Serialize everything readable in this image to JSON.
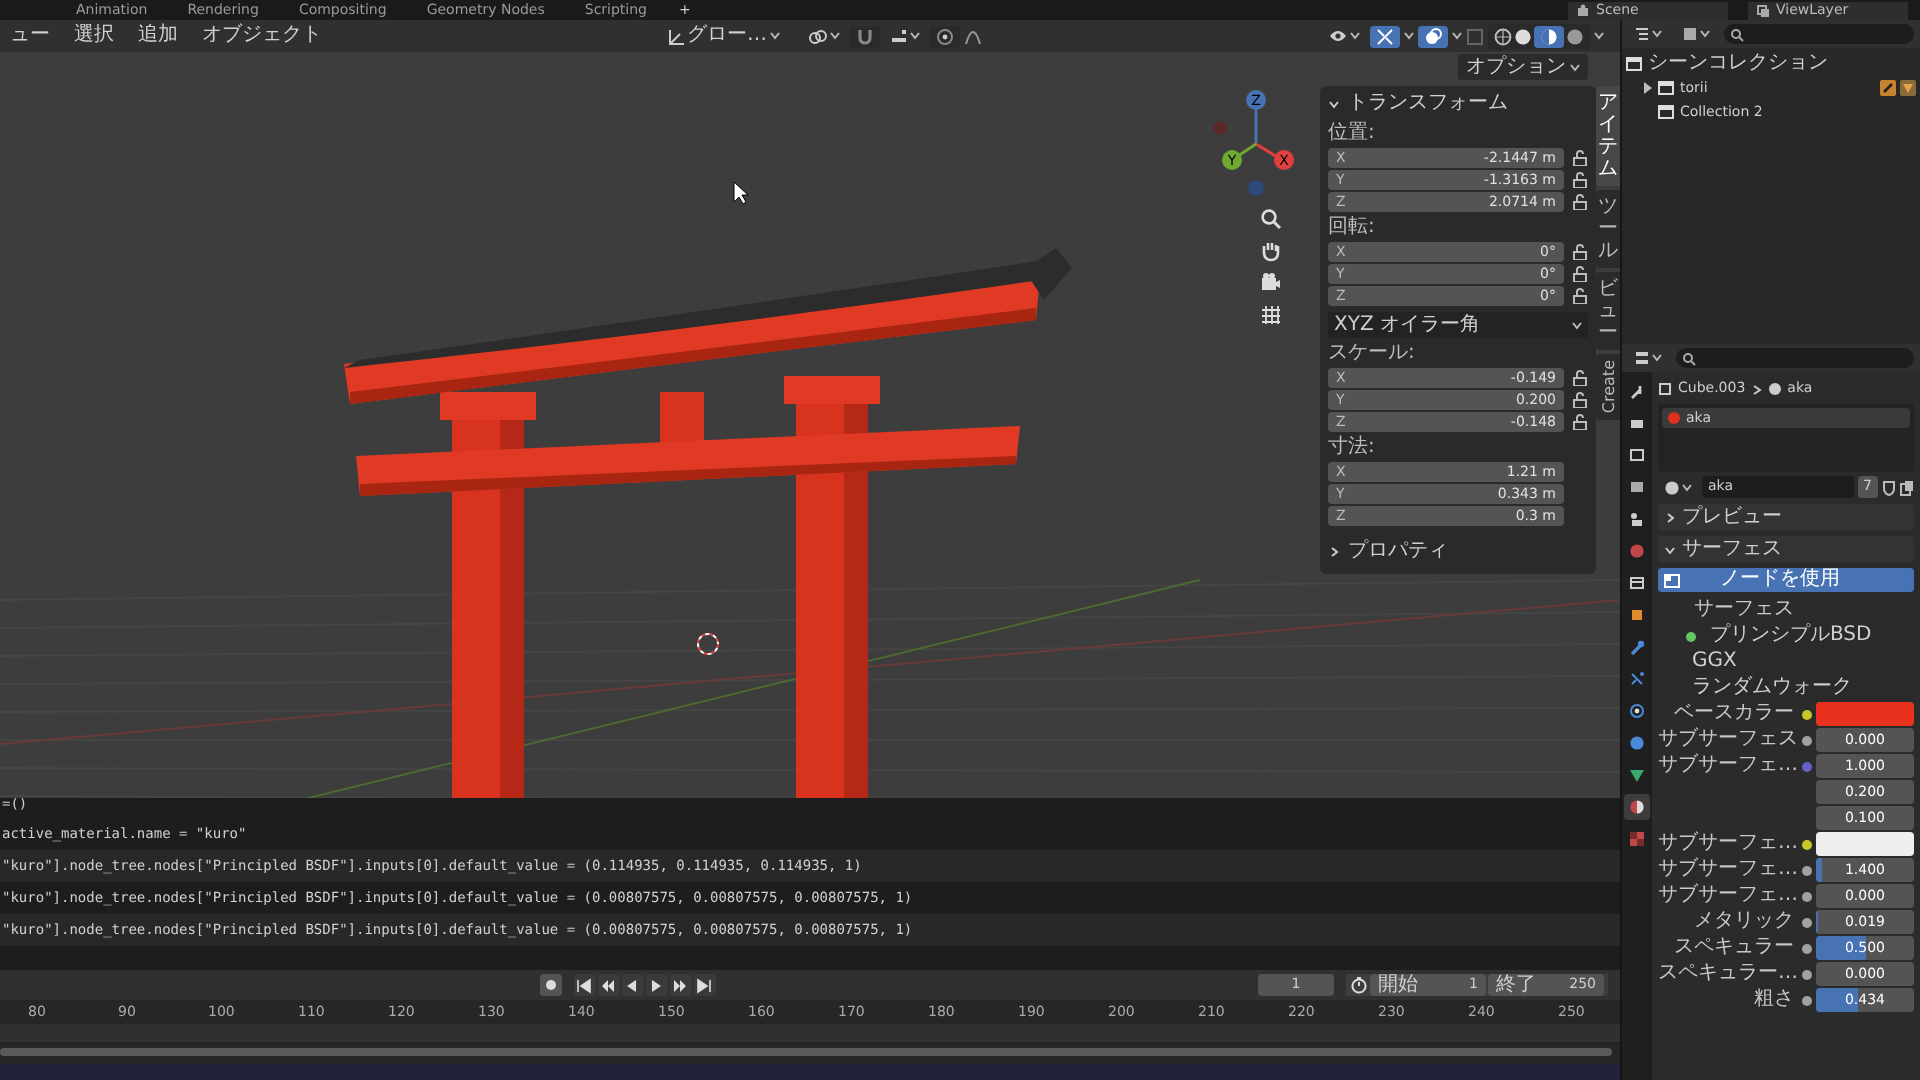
{
  "workspace_tabs": [
    {
      "label": "Animation",
      "selected": false
    },
    {
      "label": "Rendering",
      "selected": false
    },
    {
      "label": "Compositing",
      "selected": false
    },
    {
      "label": "Geometry Nodes",
      "selected": false
    },
    {
      "label": "Scripting",
      "selected": false
    }
  ],
  "add_workspace": "+",
  "scene": "Scene",
  "view_layer": "ViewLayer",
  "viewport": {
    "menus": [
      "ュー",
      "選択",
      "追加",
      "オブジェクト"
    ],
    "orientation": "グロー…",
    "options": "オプション",
    "gizmo_axes": [
      "Z",
      "Y",
      "X"
    ],
    "sidebar_tabs": [
      {
        "label": "アイテム",
        "selected": true
      },
      {
        "label": "ツール",
        "selected": false
      },
      {
        "label": "ビュー",
        "selected": false
      },
      {
        "label": "Create",
        "selected": false
      }
    ],
    "transform": {
      "title": "トランスフォーム",
      "expanded": true,
      "groups": [
        {
          "kind": "fields",
          "label": "位置:",
          "locks": true,
          "fields": [
            {
              "axis": "X",
              "value": "-2.1447 m"
            },
            {
              "axis": "Y",
              "value": "-1.3163 m"
            },
            {
              "axis": "Z",
              "value": "2.0714 m"
            }
          ]
        },
        {
          "kind": "fields",
          "label": "回転:",
          "locks": true,
          "fields": [
            {
              "axis": "X",
              "value": "0°"
            },
            {
              "axis": "Y",
              "value": "0°"
            },
            {
              "axis": "Z",
              "value": "0°"
            }
          ]
        },
        {
          "kind": "dropdown",
          "value": "XYZ オイラー角"
        },
        {
          "kind": "fields",
          "label": "スケール:",
          "locks": true,
          "fields": [
            {
              "axis": "X",
              "value": "-0.149"
            },
            {
              "axis": "Y",
              "value": "0.200"
            },
            {
              "axis": "Z",
              "value": "-0.148"
            }
          ]
        },
        {
          "kind": "fields",
          "label": "寸法:",
          "locks": false,
          "fields": [
            {
              "axis": "X",
              "value": "1.21 m"
            },
            {
              "axis": "Y",
              "value": "0.343 m"
            },
            {
              "axis": "Z",
              "value": "0.3 m"
            }
          ]
        }
      ]
    },
    "properties_section": {
      "title": "プロパティ",
      "expanded": false
    }
  },
  "console": {
    "lines": [
      "=()",
      "active_material.name = \"kuro\"",
      "\"kuro\"].node_tree.nodes[\"Principled BSDF\"].inputs[0].default_value = (0.114935, 0.114935, 0.114935, 1)",
      "\"kuro\"].node_tree.nodes[\"Principled BSDF\"].inputs[0].default_value = (0.00807575, 0.00807575, 0.00807575, 1)",
      "\"kuro\"].node_tree.nodes[\"Principled BSDF\"].inputs[0].default_value = (0.00807575, 0.00807575, 0.00807575, 1)"
    ]
  },
  "timeline": {
    "current_frame": "1",
    "start_label": "開始",
    "start": "1",
    "end_label": "終了",
    "end": "250",
    "ticks": [
      "80",
      "90",
      "100",
      "110",
      "120",
      "130",
      "140",
      "150",
      "160",
      "170",
      "180",
      "190",
      "200",
      "210",
      "220",
      "230",
      "240",
      "250"
    ]
  },
  "outliner": {
    "items": [
      {
        "label": "シーンコレクション",
        "children": [
          {
            "label": "torii",
            "expanded": false
          },
          {
            "label": "Collection 2"
          }
        ]
      }
    ]
  },
  "properties": {
    "tabs": [
      {
        "selected": false
      },
      {
        "selected": false
      },
      {
        "selected": false
      },
      {
        "selected": false
      },
      {
        "selected": false
      },
      {
        "selected": false
      },
      {
        "selected": false
      },
      {
        "selected": false
      },
      {
        "selected": false
      },
      {
        "selected": false
      },
      {
        "selected": false
      },
      {
        "selected": false
      },
      {
        "selected": false
      },
      {
        "selected": true
      },
      {
        "selected": false
      }
    ],
    "breadcrumb": [
      "Cube.003",
      "aka"
    ],
    "material_slots": [
      {
        "name": "aka",
        "color": "#e0301e",
        "selected": true
      }
    ],
    "material_name": "aka",
    "users": "7",
    "panels": [
      {
        "title": "プレビュー",
        "expanded": false
      },
      {
        "title": "サーフェス",
        "expanded": true
      }
    ],
    "use_nodes": "ノードを使用",
    "rows": [
      {
        "kind": "shader",
        "label": "サーフェス",
        "value": "プリンシプルBSD"
      },
      {
        "kind": "dropdown",
        "value": "GGX"
      },
      {
        "kind": "dropdown",
        "value": "ランダムウォーク"
      },
      {
        "kind": "color",
        "label": "ベースカラー",
        "color": "#e8321e"
      },
      {
        "kind": "value",
        "label": "サブサーフェス",
        "value": "0.000",
        "level": 0
      },
      {
        "kind": "vector",
        "label": "サブサーフェ…",
        "values": [
          "1.000",
          "0.200",
          "0.100"
        ]
      },
      {
        "kind": "color",
        "label": "サブサーフェ…",
        "color": "#eeeeee"
      },
      {
        "kind": "value",
        "label": "サブサーフェ…",
        "value": "1.400",
        "level": 0.07
      },
      {
        "kind": "value",
        "label": "サブサーフェ…",
        "value": "0.000",
        "level": 0
      },
      {
        "kind": "value",
        "label": "メタリック",
        "value": "0.019",
        "level": 0.019
      },
      {
        "kind": "value",
        "label": "スペキュラー",
        "value": "0.500",
        "level": 0.5
      },
      {
        "kind": "value",
        "label": "スペキュラー…",
        "value": "0.000",
        "level": 0
      },
      {
        "kind": "value",
        "label": "粗さ",
        "value": "0.434",
        "level": 0.434
      }
    ]
  }
}
